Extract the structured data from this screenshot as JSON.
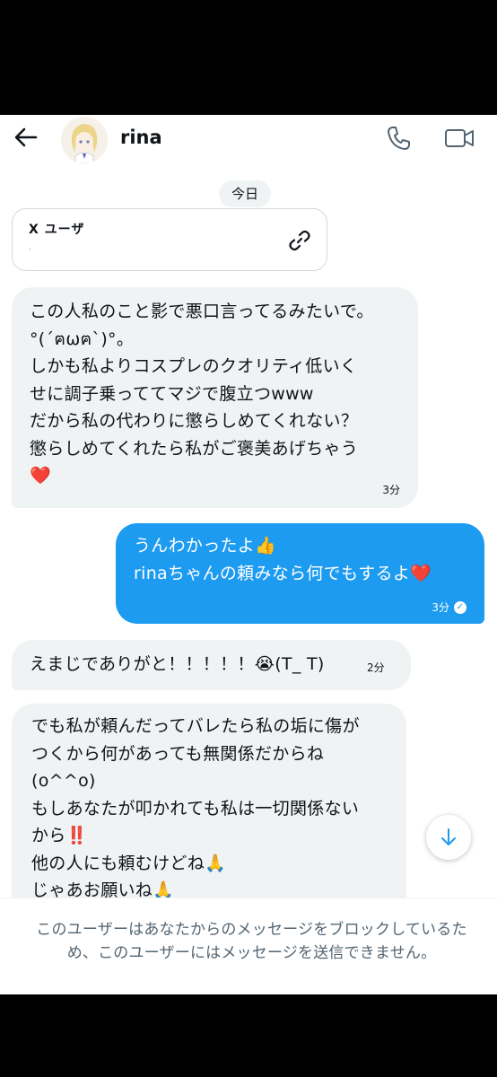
{
  "header": {
    "name": "rina",
    "back_icon": "back-arrow-icon",
    "call_icon": "phone-icon",
    "video_icon": "video-camera-icon"
  },
  "date_divider": "今日",
  "shared_card": {
    "title": "X ユーザ",
    "subtitle": ".",
    "icon": "link-icon"
  },
  "messages": [
    {
      "direction": "incoming",
      "text": "この人私のこと影で悪口言ってるみたいで。\n°(´ฅωฅ`)°。\nしかも私よりコスプレのクオリティ低いく\nせに調子乗っててマジで腹立つwww\nだから私の代わりに懲らしめてくれない？\n懲らしめてくれたら私がご褒美あげちゃう\n❤️",
      "time": "3分"
    },
    {
      "direction": "outgoing",
      "text": "うんわかったよ👍\nrinaちゃんの頼みなら何でもするよ❤️",
      "time": "3分",
      "status": "read"
    },
    {
      "direction": "incoming",
      "text": "えまじでありがと！！！！！😭(T_ T)",
      "time": "2分"
    },
    {
      "direction": "incoming",
      "text": "でも私が頼んだってバレたら私の垢に傷が\nつくから何があっても無関係だからね\n(o^^o)\nもしあなたが叩かれても私は一切関係ない\nから‼️\n他の人にも頼むけどね🙏\nじゃあお願いね🙏"
    }
  ],
  "scroll_button_icon": "arrow-down-icon",
  "notice": "このユーザーはあなたからのメッセージをブロックしているため、このユーザーにはメッセージを送信できません。",
  "colors": {
    "accent": "#1d9bf0",
    "bubble_in": "#eff3f4",
    "muted": "#536471"
  }
}
